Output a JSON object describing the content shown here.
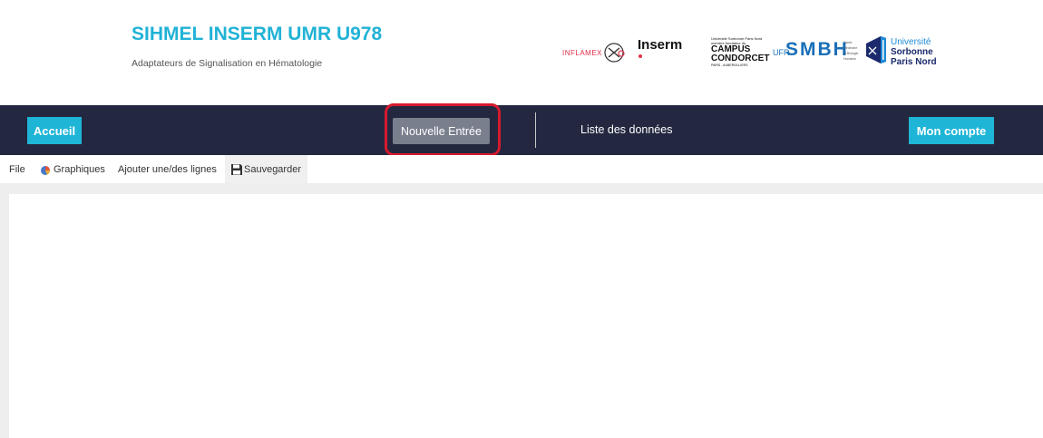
{
  "header": {
    "title": "SIHMEL INSERM UMR U978",
    "subtitle": "Adaptateurs de Signalisation en Hématologie",
    "logos": {
      "inflamex": "INFLAMEX",
      "inserm": "Inserm",
      "campus_top": "Université Sorbonne Paris Nord",
      "campus_mid": "membre fondateur du",
      "campus_main1": "CAMPUS",
      "campus_main2": "CONDORCET",
      "campus_bottom": "PARIS - AUBERVILLIERS",
      "ufr": "UFR",
      "smbh": "SMBH",
      "smbh_sub1": "Santé,",
      "smbh_sub2": "Médecine",
      "smbh_sub3": "et Biologie",
      "smbh_sub4": "Humaine",
      "usp_1": "Université",
      "usp_2": "Sorbonne",
      "usp_3": "Paris Nord"
    }
  },
  "nav": {
    "accueil": "Accueil",
    "nouvelle_entree": "Nouvelle Entrée",
    "liste": "Liste des données",
    "mon_compte": "Mon compte"
  },
  "toolbar": {
    "file": "File",
    "graphiques": "Graphiques",
    "ajouter": "Ajouter une/des lignes",
    "sauvegarder": "Sauvegarder"
  },
  "colors": {
    "accent": "#1fb5d6",
    "navbar": "#232840",
    "highlight": "#d6192e",
    "title": "#20b2d6"
  }
}
